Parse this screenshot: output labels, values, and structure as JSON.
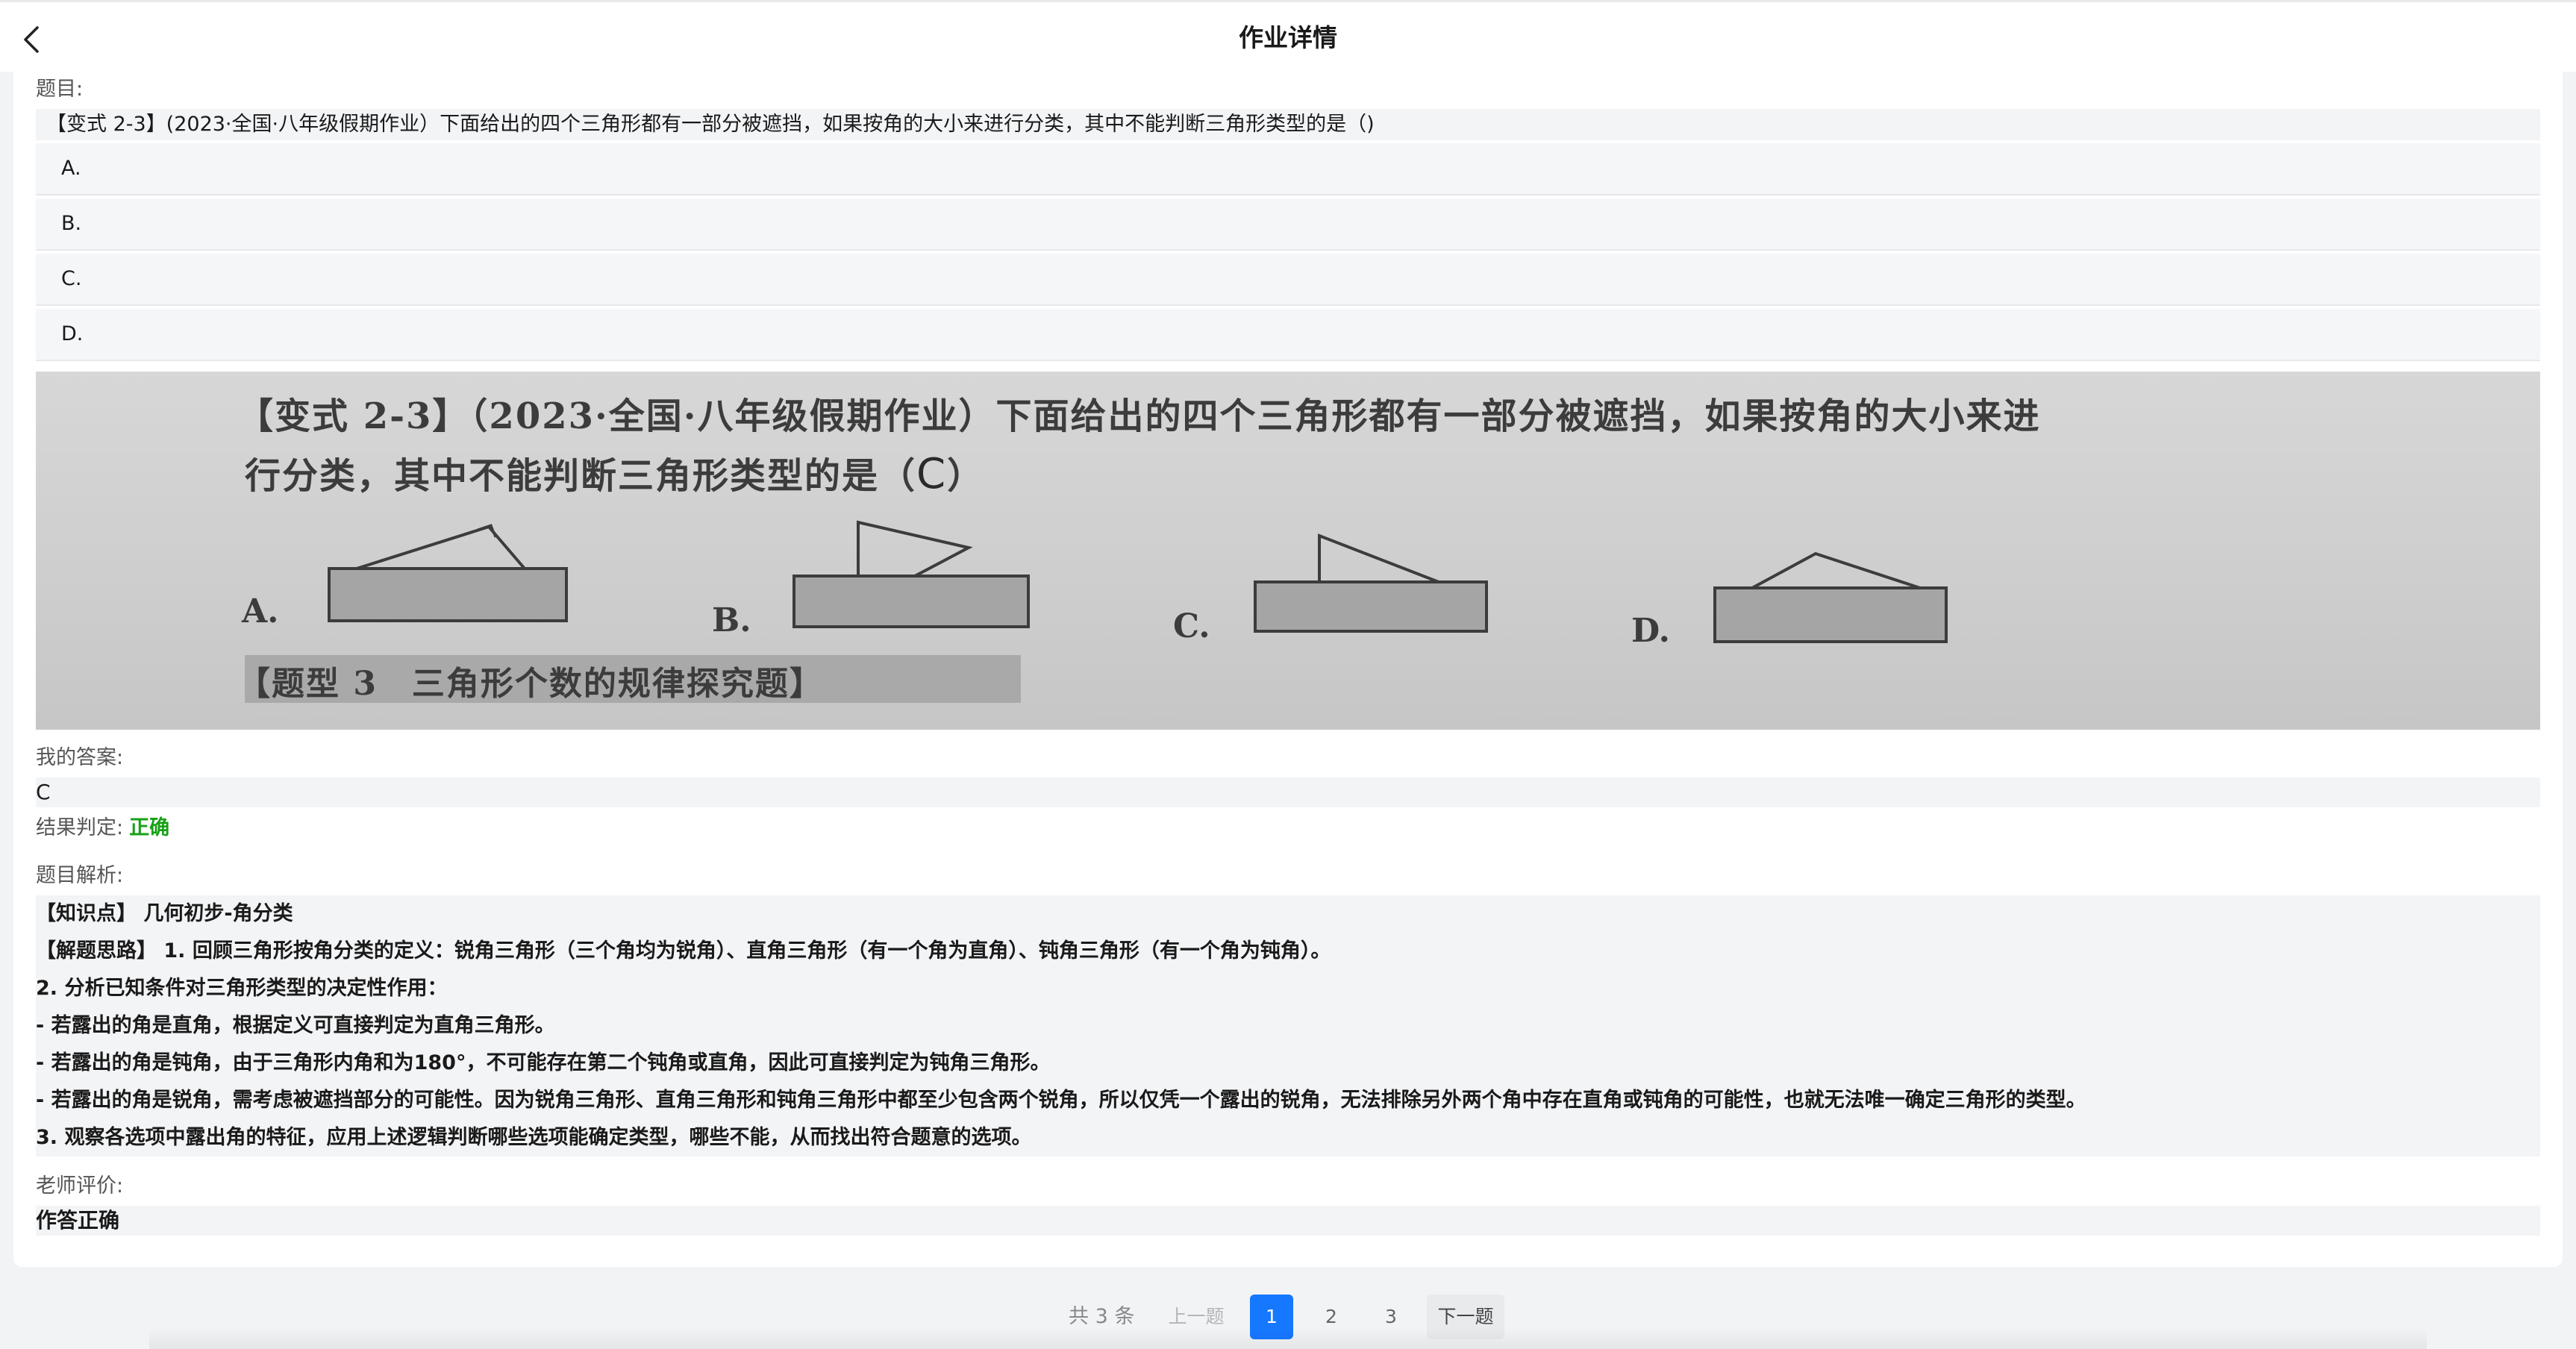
{
  "header": {
    "title": "作业详情"
  },
  "question": {
    "label": "题目:",
    "text": "【变式 2-3】(2023·全国·八年级假期作业）下面给出的四个三角形都有一部分被遮挡，如果按角的大小来进行分类，其中不能判断三角形类型的是（)",
    "options": [
      "A.",
      "B.",
      "C.",
      "D."
    ],
    "photo": {
      "line1": "【变式 2-3】（2023·全国·八年级假期作业）下面给出的四个三角形都有一部分被遮挡，如果按角的大小来进",
      "line2": "行分类，其中不能判断三角形类型的是（",
      "handwritten_answer": "C",
      "line2_end": "）",
      "option_labels": [
        "A.",
        "B.",
        "C.",
        "D."
      ],
      "footer": "【题型 3　三角形个数的规律探究题】"
    }
  },
  "my_answer": {
    "label": "我的答案:",
    "value": "C"
  },
  "result": {
    "label": "结果判定:",
    "value": "正确",
    "color": "#18a018"
  },
  "analysis": {
    "label": "题目解析:",
    "lines": [
      "【知识点】 几何初步-角分类",
      "【解题思路】 1. 回顾三角形按角分类的定义：锐角三角形（三个角均为锐角）、直角三角形（有一个角为直角）、钝角三角形（有一个角为钝角）。",
      "2. 分析已知条件对三角形类型的决定性作用：",
      "- 若露出的角是直角，根据定义可直接判定为直角三角形。",
      "- 若露出的角是钝角，由于三角形内角和为180°，不可能存在第二个钝角或直角，因此可直接判定为钝角三角形。",
      "- 若露出的角是锐角，需考虑被遮挡部分的可能性。因为锐角三角形、直角三角形和钝角三角形中都至少包含两个锐角，所以仅凭一个露出的锐角，无法排除另外两个角中存在直角或钝角的可能性，也就无法唯一确定三角形的类型。",
      "3. 观察各选项中露出角的特征，应用上述逻辑判断哪些选项能确定类型，哪些不能，从而找出符合题意的选项。"
    ]
  },
  "teacher_comment": {
    "label": "老师评价:",
    "value": "作答正确"
  },
  "pagination": {
    "total": "共 3 条",
    "prev": "上一题",
    "pages": [
      "1",
      "2",
      "3"
    ],
    "current": "1",
    "next": "下一题",
    "accent": "#1677ff"
  }
}
